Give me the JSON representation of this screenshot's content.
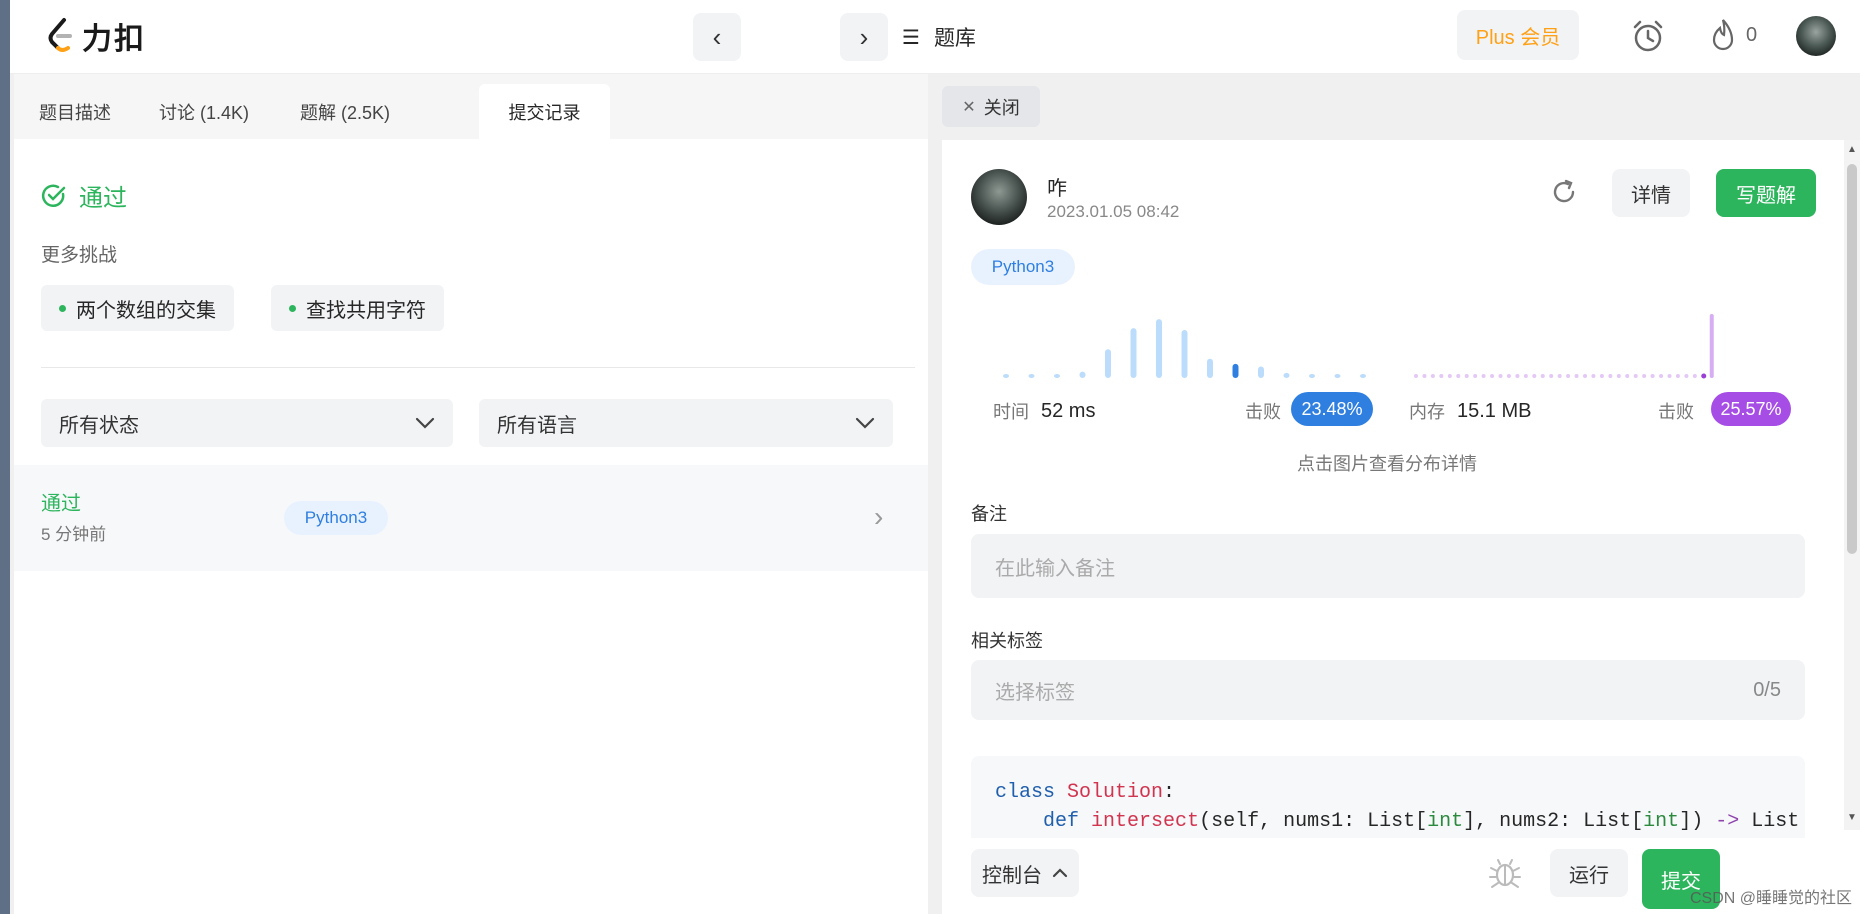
{
  "header": {
    "logo_text": "力扣",
    "problems_label": "题库",
    "plus_label": "Plus 会员",
    "streak_count": "0"
  },
  "left": {
    "tabs": [
      {
        "label": "题目描述"
      },
      {
        "label": "讨论 (1.4K)"
      },
      {
        "label": "题解 (2.5K)"
      },
      {
        "label": "提交记录"
      }
    ],
    "result_label": "通过",
    "more_challenges_label": "更多挑战",
    "challenges": [
      {
        "label": "两个数组的交集"
      },
      {
        "label": "查找共用字符"
      }
    ],
    "filters": {
      "status": "所有状态",
      "language": "所有语言"
    },
    "submission": {
      "status": "通过",
      "time_ago": "5 分钟前",
      "language": "Python3"
    }
  },
  "right": {
    "close_label": "关闭",
    "author": {
      "name": "咋",
      "date": "2023.01.05 08:42"
    },
    "detail_label": "详情",
    "write_solution_label": "写题解",
    "language_tag": "Python3",
    "runtime": {
      "label": "时间",
      "value": "52 ms",
      "beats_label": "击败",
      "beats": "23.48%"
    },
    "memory": {
      "label": "内存",
      "value": "15.1 MB",
      "beats_label": "击败",
      "beats": "25.57%"
    },
    "chart_hint": "点击图片查看分布详情",
    "note_label": "备注",
    "note_placeholder": "在此输入备注",
    "tags_label": "相关标签",
    "tags_placeholder": "选择标签",
    "tags_count": "0/5",
    "code_lines": [
      "class Solution:",
      "    def intersect(self, nums1: List[int], nums2: List[int]) -> List"
    ]
  },
  "runtime_distribution": {
    "bars": [
      0.04,
      0.04,
      0.04,
      0.1,
      0.45,
      0.78,
      0.92,
      0.75,
      0.3,
      0.22,
      0.18,
      0.08,
      0.04,
      0.04,
      0.04
    ],
    "highlight_index": 9,
    "color": "#bcdcfb",
    "highlight_color": "#2f7fe0"
  },
  "memory_distribution": {
    "dot_count": 36,
    "highlight_index": 35,
    "color": "#e4c8f6",
    "highlight_color": "#9b3fd6",
    "spike_value": 1.0
  },
  "bottom": {
    "console_label": "控制台",
    "run_label": "运行",
    "submit_label": "提交"
  },
  "watermark": "CSDN @睡睡觉的社区",
  "colors": {
    "accent_green": "#2db55d",
    "accent_blue": "#2f7fe0",
    "accent_purple": "#a64de6",
    "plus_orange": "#ffa116"
  }
}
